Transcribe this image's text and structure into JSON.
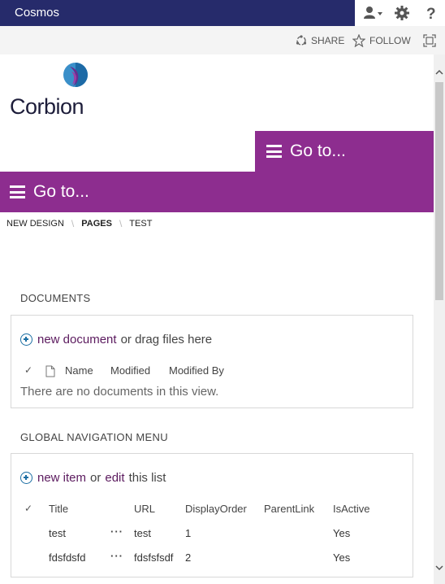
{
  "suitebar": {
    "brand": "Cosmos"
  },
  "subbar": {
    "share_label": "SHARE",
    "follow_label": "FOLLOW"
  },
  "site": {
    "logo_text": "Corbion",
    "goto_small_label": "Go to...",
    "goto_big_label": "Go to..."
  },
  "breadcrumb": [
    "NEW DESIGN",
    "PAGES",
    "TEST"
  ],
  "documents": {
    "title": "DOCUMENTS",
    "new_link": "new document",
    "new_suffix": "or drag files here",
    "columns": [
      "Name",
      "Modified",
      "Modified By"
    ],
    "empty_message": "There are no documents in this view."
  },
  "global_nav": {
    "title": "GLOBAL NAVIGATION MENU",
    "new_link": "new item",
    "or_text": "or",
    "edit_link": "edit",
    "edit_suffix": "this list",
    "columns": [
      "Title",
      "URL",
      "DisplayOrder",
      "ParentLink",
      "IsActive"
    ],
    "rows": [
      {
        "title": "test",
        "url": "test",
        "display_order": "1",
        "parent_link": "",
        "is_active": "Yes"
      },
      {
        "title": "fdsfdsfd",
        "url": "fdsfsfsdf",
        "display_order": "2",
        "parent_link": "",
        "is_active": "Yes"
      }
    ]
  },
  "colors": {
    "suitebar_bg": "#262b6b",
    "brand_purple": "#8d2d8f",
    "link": "#5b1a5e",
    "accent_blue": "#1b6ea3"
  }
}
